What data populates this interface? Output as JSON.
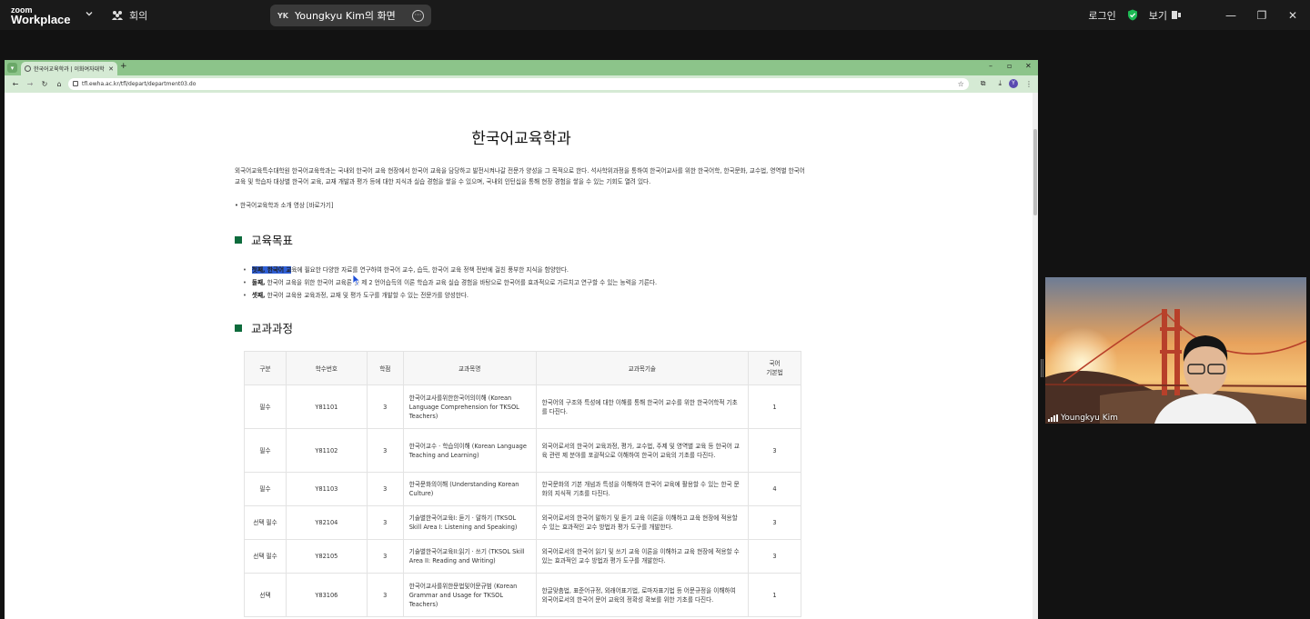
{
  "zoom": {
    "logo_line1": "zoom",
    "logo_line2": "Workplace",
    "meeting_label": "회의",
    "share_initials": "YK",
    "share_name": "Youngkyu Kim의 화면",
    "signin_label": "로그인",
    "view_label": "보기"
  },
  "browser": {
    "tab_title": "한국어교육학과 | 이화여자대학",
    "url": "tfl.ewha.ac.kr/tfl/depart/department03.do",
    "profile_initial": "Y"
  },
  "page": {
    "title": "한국어교육학과",
    "intro": "외국어교육특수대학원 한국어교육학과는 국내외 한국어 교육 현장에서 한국어 교육을 담당하고 발전시켜나갈 전문가 양성을 그 목적으로 한다. 석사학위과정을 통하여 한국어교사를 위한 한국어학, 한국문화, 교수법, 영역별 한국어 교육 및 학습자 대상별 한국어 교육, 교재 개발과 평가 등에 대한 지식과 실습 경험을 쌓을 수 있으며, 국내외 인턴십을 통해 현장 경험을 쌓을 수 있는 기회도 열려 있다.",
    "video_link": "한국어교육학과 소개 영상 [바로가기]",
    "goals_heading": "교육목표",
    "goals": [
      {
        "lead_hl": "첫째, 한국어 교",
        "rest": "육에 필요한 다양한 자료를 연구하여 한국어 교수, 습득, 한국어 교육 정책 전반에 걸친 풍부한 지식을 함양한다."
      },
      {
        "lead": "둘째,",
        "rest": " 한국어 교육을 위한 한국어 교육론 및 제 2 언어습득의 이론 학습과 교육 실습 경험을 바탕으로 한국어를 효과적으로 가르치고 연구할 수 있는 능력을 기른다."
      },
      {
        "lead": "셋째,",
        "rest": " 한국어 교육용 교육과정, 교재 및 평가 도구를 개발할 수 있는 전문가를 양성한다."
      }
    ],
    "curriculum_heading": "교과과정",
    "table": {
      "headers": [
        "구분",
        "학수번호",
        "학점",
        "교과목명",
        "교과목기술",
        "국어\n기본법"
      ],
      "rows": [
        [
          "필수",
          "Y81101",
          "3",
          "한국어교사를위한한국어의이해 (Korean Language Comprehension for TKSOL Teachers)",
          "한국어의 구조와 특성에 대한 이해를 통해 한국어 교수를 위한 한국어학적 기초를 다진다.",
          "1"
        ],
        [
          "필수",
          "Y81102",
          "3",
          "한국어교수 · 학습의이해 (Korean Language Teaching and Learning)",
          "외국어로서의 한국어 교육과정, 평가, 교수법, 주제 및 영역별 교육 등 한국어 교육 관련 제 분야를 포괄적으로 이해하여 한국어 교육의 기초를 다진다.",
          "3"
        ],
        [
          "필수",
          "Y81103",
          "3",
          "한국문화의이해 (Understanding Korean Culture)",
          "한국문화의 기본 개념과 특성을 이해하여 한국어 교육에 활용할 수 있는 한국 문화의 지식적 기초를 다진다.",
          "4"
        ],
        [
          "선택 필수",
          "Y82104",
          "3",
          "기술별한국어교육I: 듣기 · 말하기 (TKSOL Skill Area I: Listening and Speaking)",
          "외국어로서의 한국어 말하기 및 듣기 교육 이론을 이해하고 교육 현장에 적용할 수 있는 효과적인 교수 방법과 평가 도구를 개발한다.",
          "3"
        ],
        [
          "선택 필수",
          "Y82105",
          "3",
          "기술별한국어교육II:읽기 · 쓰기 (TKSOL Skill Area II: Reading and Writing)",
          "외국어로서의 한국어 읽기 및 쓰기 교육 이론을 이해하고 교육 현장에 적용할 수 있는 효과적인 교수 방법과 평가 도구를 개발한다.",
          "3"
        ],
        [
          "선택",
          "Y83106",
          "3",
          "한국어교사를위한문법및어문규범 (Korean Grammar and Usage for TKSOL Teachers)",
          "한글맞춤법, 표준어규정, 외래어표기법, 로마자표기법 등 어문규정을 이해하여 외국어로서의 한국어 문어 교육의 정확성 확보를 위한 기초를 다진다.",
          "1"
        ]
      ]
    }
  },
  "camera": {
    "participant_name": "Youngkyu Kim"
  }
}
